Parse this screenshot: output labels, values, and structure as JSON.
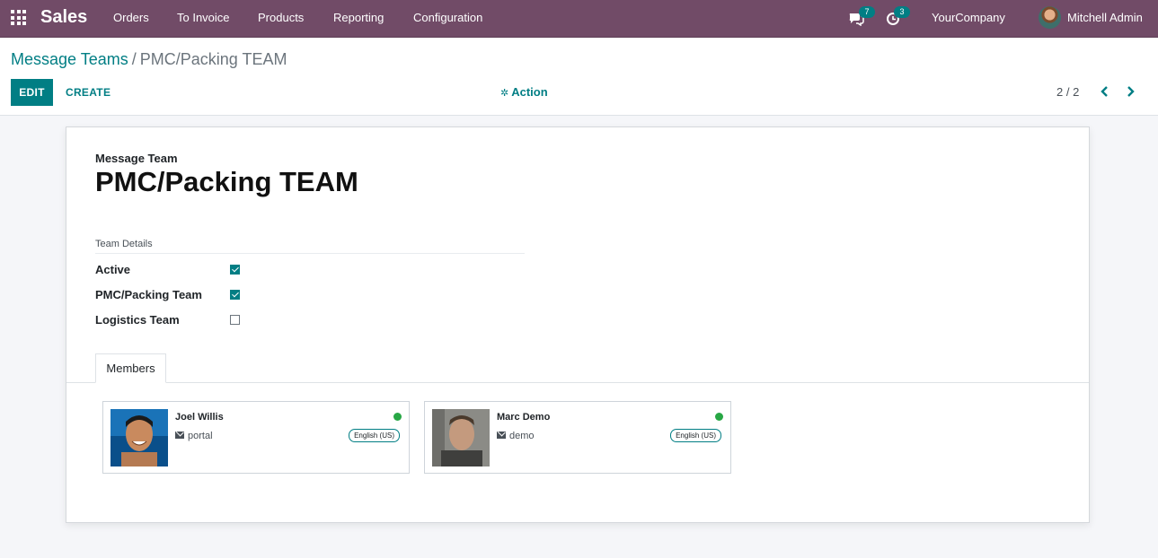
{
  "navbar": {
    "app_name": "Sales",
    "menu": [
      "Orders",
      "To Invoice",
      "Products",
      "Reporting",
      "Configuration"
    ],
    "messages_count": "7",
    "activities_count": "3",
    "company": "YourCompany",
    "user": "Mitchell Admin",
    "color": "#714b67"
  },
  "control_panel": {
    "breadcrumb_parent": "Message Teams",
    "breadcrumb_separator": "/",
    "breadcrumb_current": "PMC/Packing TEAM",
    "edit_label": "EDIT",
    "create_label": "CREATE",
    "action_label": "Action",
    "pager": "2 / 2",
    "accent": "#017e84"
  },
  "form": {
    "name_label": "Message Team",
    "name": "PMC/Packing TEAM",
    "group_title": "Team Details",
    "fields": [
      {
        "label": "Active",
        "checked": true
      },
      {
        "label": "PMC/Packing Team",
        "checked": true
      },
      {
        "label": "Logistics Team",
        "checked": false
      }
    ],
    "tab_label": "Members",
    "members": [
      {
        "name": "Joel Willis",
        "login": "portal",
        "lang": "English (US)",
        "status": "online"
      },
      {
        "name": "Marc Demo",
        "login": "demo",
        "lang": "English (US)",
        "status": "online"
      }
    ]
  }
}
